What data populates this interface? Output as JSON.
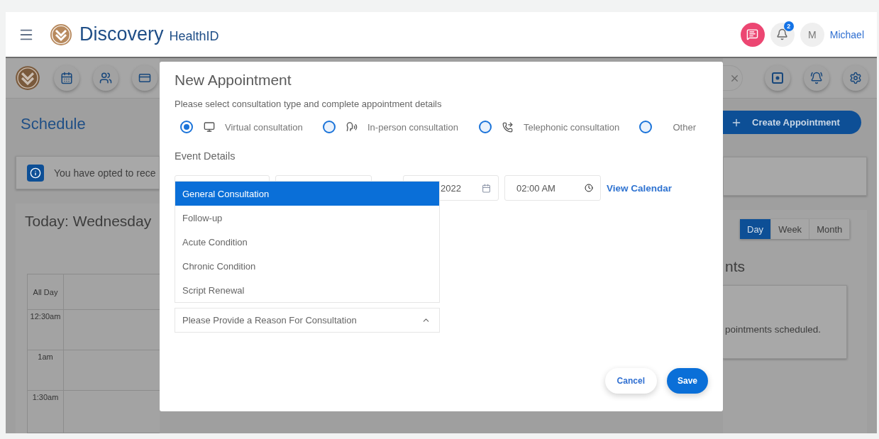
{
  "header": {
    "brand": "Discovery",
    "product": "HealthID",
    "notification_count": "2",
    "avatar_initial": "M",
    "user_name": "Michael"
  },
  "background": {
    "page_title": "Schedule",
    "banner_text": "You have opted to rece",
    "calendar_title": "Today: Wednesday",
    "create_button": "Create Appointment",
    "views": [
      {
        "label": "Day",
        "selected": true
      },
      {
        "label": "Week",
        "selected": false
      },
      {
        "label": "Month",
        "selected": false
      }
    ],
    "all_day_label": "All Day",
    "time_slots": [
      "12:30am",
      "1am",
      "1:30am"
    ],
    "appointments_heading": "nts",
    "appointments_empty": "pointments scheduled."
  },
  "dialog": {
    "title": "New Appointment",
    "instructions": "Please select consultation type and complete appointment details",
    "consultation_types": [
      {
        "label": "Virtual consultation",
        "selected": true,
        "kind": "virtual"
      },
      {
        "label": "In-person consultation",
        "selected": false,
        "kind": "in_person"
      },
      {
        "label": "Telephonic consultation",
        "selected": false,
        "kind": "telephonic"
      },
      {
        "label": "Other",
        "selected": false,
        "kind": "other"
      }
    ],
    "section_title": "Event Details",
    "date_value": "2022",
    "time_value": "02:00 AM",
    "calendar_link": "View Calendar",
    "reason_options": [
      {
        "label": "General Consultation",
        "selected": true
      },
      {
        "label": "Follow-up",
        "selected": false
      },
      {
        "label": "Acute Condition",
        "selected": false
      },
      {
        "label": "Chronic Condition",
        "selected": false
      },
      {
        "label": "Script Renewal",
        "selected": false
      }
    ],
    "reason_placeholder": "Please Provide a Reason For Consultation",
    "buttons": [
      {
        "label": "Cancel",
        "kind": "secondary"
      },
      {
        "label": "Save",
        "kind": "primary"
      }
    ]
  }
}
